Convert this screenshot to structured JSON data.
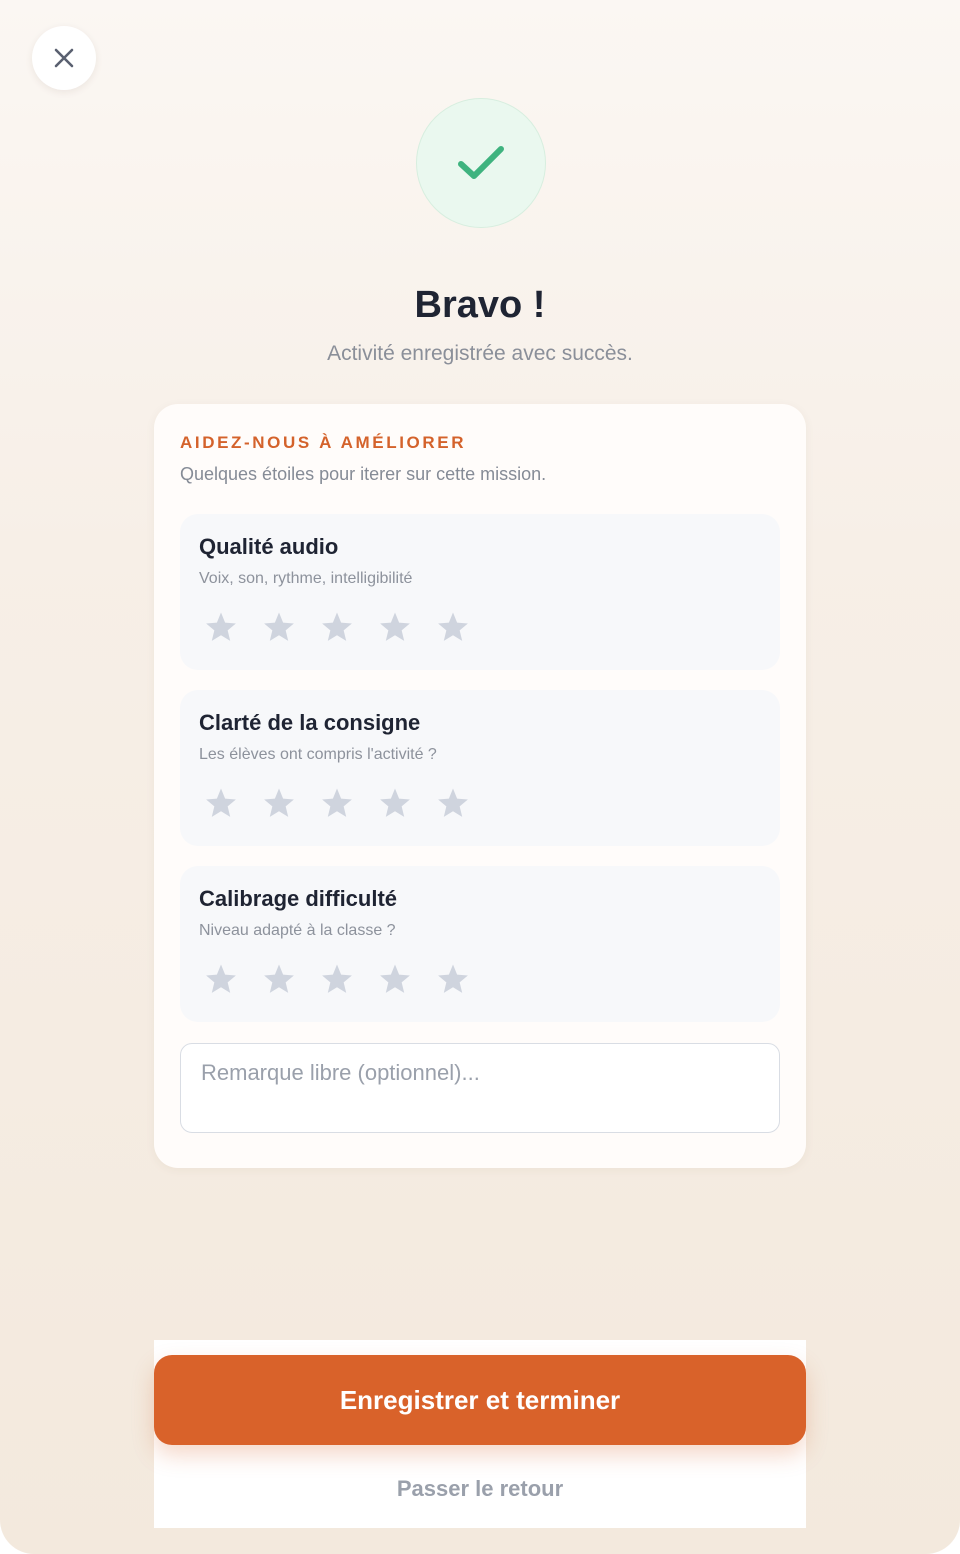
{
  "header": {
    "close_icon": "close-icon"
  },
  "success": {
    "icon": "check-icon",
    "icon_color": "#3fb37f",
    "title": "Bravo !",
    "message": "Activité enregistrée avec succès."
  },
  "feedback": {
    "heading": "AIDEZ-NOUS À AMÉLIORER",
    "subheading": "Quelques étoiles pour iterer sur cette mission.",
    "accent_color": "#d4622b",
    "criteria": [
      {
        "title": "Qualité audio",
        "description": "Voix, son, rythme, intelligibilité",
        "rating": 0,
        "max_rating": 5
      },
      {
        "title": "Clarté de la consigne",
        "description": "Les élèves ont compris l'activité ?",
        "rating": 0,
        "max_rating": 5
      },
      {
        "title": "Calibrage difficulté",
        "description": "Niveau adapté à la classe ?",
        "rating": 0,
        "max_rating": 5
      }
    ],
    "remark": {
      "value": "",
      "placeholder": "Remarque libre (optionnel)..."
    }
  },
  "actions": {
    "primary_label": "Enregistrer et terminer",
    "primary_color": "#d9622a",
    "skip_label": "Passer le retour"
  }
}
